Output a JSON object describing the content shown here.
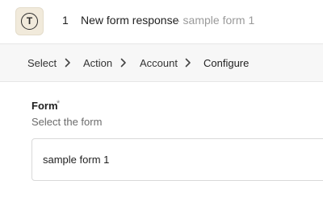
{
  "header": {
    "app_icon_letter": "T",
    "step_number": "1",
    "step_title": "New form response",
    "step_subtitle": "- sample form 1"
  },
  "breadcrumb": {
    "items": [
      "Select",
      "Action",
      "Account",
      "Configure"
    ],
    "active_index": 3
  },
  "field": {
    "label": "Form",
    "required_marker": "*",
    "help_text": "Select the form",
    "value": "sample form 1"
  }
}
